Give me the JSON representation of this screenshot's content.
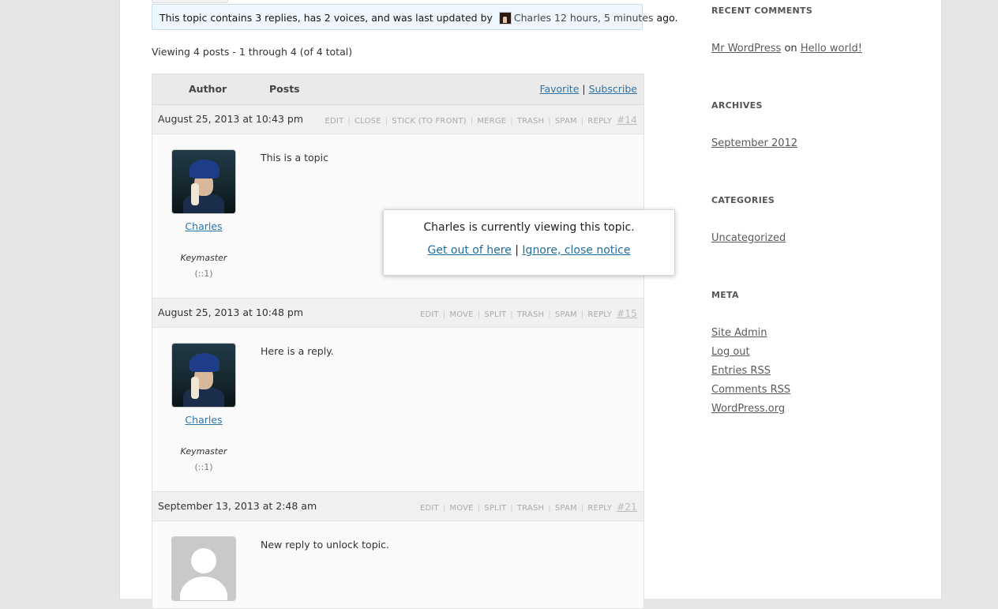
{
  "topic_info": {
    "text": "This topic contains 3 replies, has 2 voices, and was last updated by",
    "user": "Charles",
    "when": "12 hours, 5 minutes",
    "suffix": "ago."
  },
  "pagination": "Viewing 4 posts - 1 through 4 (of 4 total)",
  "forum_header": {
    "author": "Author",
    "posts": "Posts",
    "favorite": "Favorite",
    "separator": "|",
    "subscribe": "Subscribe"
  },
  "posts": [
    {
      "date": "August 25, 2013 at 10:43 pm",
      "actions": [
        "EDIT",
        "CLOSE",
        "STICK (TO FRONT)",
        "MERGE",
        "TRASH",
        "SPAM",
        "REPLY"
      ],
      "permalink": "#14",
      "author": "Charles",
      "role": "Keymaster",
      "ip": "(::1)",
      "content": "This is a topic"
    },
    {
      "date": "August 25, 2013 at 10:48 pm",
      "actions": [
        "EDIT",
        "MOVE",
        "SPLIT",
        "TRASH",
        "SPAM",
        "REPLY"
      ],
      "permalink": "#15",
      "author": "Charles",
      "role": "Keymaster",
      "ip": "(::1)",
      "content": "Here is a reply."
    },
    {
      "date": "September 13, 2013 at 2:48 am",
      "actions": [
        "EDIT",
        "MOVE",
        "SPLIT",
        "TRASH",
        "SPAM",
        "REPLY"
      ],
      "permalink": "#21",
      "content": "New reply to unlock topic."
    }
  ],
  "sidebar": {
    "recent_comments": {
      "title": "RECENT COMMENTS",
      "author": "Mr WordPress",
      "on": "on",
      "post": "Hello world!"
    },
    "archives": {
      "title": "ARCHIVES",
      "items": [
        "September 2012"
      ]
    },
    "categories": {
      "title": "CATEGORIES",
      "items": [
        "Uncategorized"
      ]
    },
    "meta": {
      "title": "META",
      "items": [
        "Site Admin",
        "Log out",
        "Entries RSS",
        "Comments RSS",
        "WordPress.org"
      ]
    }
  },
  "notice": {
    "message": "Charles is currently viewing this topic.",
    "leave": "Get out of here",
    "separator": "|",
    "ignore": "Ignore, close notice"
  }
}
